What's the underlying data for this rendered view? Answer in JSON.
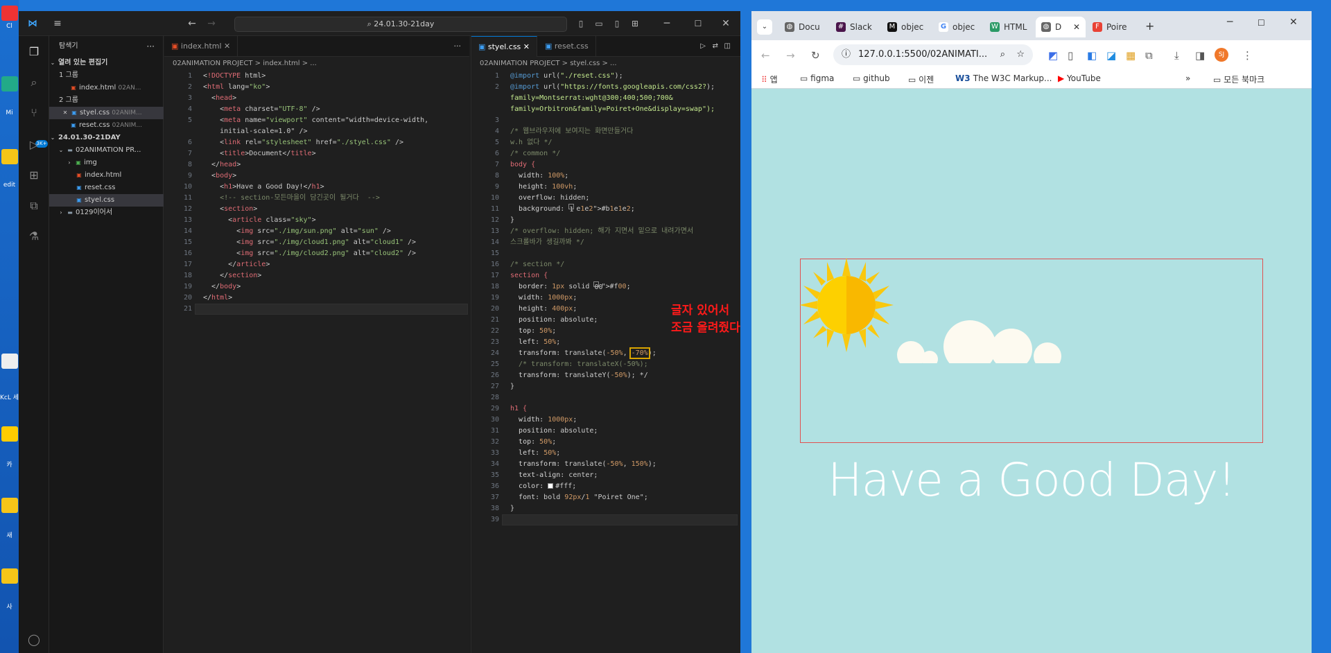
{
  "desktop": {
    "labels": [
      "Cl",
      "Mi",
      "edit",
      "KcL\n세무",
      "카",
      "새",
      "사"
    ]
  },
  "vscode": {
    "search_text": "24.01.30-21day",
    "explorer": {
      "title": "탐색기",
      "open_editors": "열려 있는 편집기",
      "group1": "1 그룹",
      "group2": "2 그룹",
      "open_files": [
        {
          "name": "index.html",
          "path": "02AN..."
        },
        {
          "name": "styel.css",
          "path": "02ANIM..."
        },
        {
          "name": "reset.css",
          "path": "02ANIM..."
        }
      ],
      "folder": "24.01.30-21DAY",
      "project": "02ANIMATION PR...",
      "items": [
        "img",
        "index.html",
        "reset.css",
        "styel.css"
      ],
      "other_folder": "0129이어서"
    },
    "left_editor": {
      "tab": "index.html",
      "breadcrumb": "02ANIMATION PROJECT > index.html > ...",
      "lines": [
        "<!DOCTYPE html>",
        "<html lang=\"ko\">",
        "  <head>",
        "    <meta charset=\"UTF-8\" />",
        "    <meta name=\"viewport\" content=\"width=device-width,",
        "    initial-scale=1.0\" />",
        "    <link rel=\"stylesheet\" href=\"./styel.css\" />",
        "    <title>Document</title>",
        "  </head>",
        "  <body>",
        "    <h1>Have a Good Day!</h1>",
        "    <!-- section-모든마을이 담긴곳이 될거다  -->",
        "    <section>",
        "      <article class=\"sky\">",
        "        <img src=\"./img/sun.png\" alt=\"sun\" />",
        "        <img src=\"./img/cloud1.png\" alt=\"cloud1\" />",
        "        <img src=\"./img/cloud2.png\" alt=\"cloud2\" />",
        "      </article>",
        "    </section>",
        "  </body>",
        "</html>",
        ""
      ],
      "line_numbers": [
        "1",
        "2",
        "3",
        "4",
        "5",
        "",
        "6",
        "7",
        "8",
        "9",
        "10",
        "11",
        "12",
        "13",
        "14",
        "15",
        "16",
        "17",
        "18",
        "19",
        "20",
        "21"
      ]
    },
    "right_editor": {
      "tab_active": "styel.css",
      "tab_other": "reset.css",
      "breadcrumb": "02ANIMATION PROJECT > styel.css > ...",
      "line_numbers": [
        "1",
        "2",
        "",
        "",
        "3",
        "4",
        "5",
        "6",
        "7",
        "8",
        "9",
        "10",
        "11",
        "12",
        "13",
        "14",
        "15",
        "16",
        "17",
        "18",
        "19",
        "20",
        "21",
        "22",
        "23",
        "24",
        "25",
        "26",
        "27",
        "28",
        "29",
        "30",
        "31",
        "32",
        "33",
        "34",
        "35",
        "36",
        "37",
        "38",
        "39"
      ],
      "lines": [
        "@import url(\"./reset.css\");",
        "@import url(\"https://fonts.googleapis.com/css2?",
        "family=Montserrat:wght@300;400;500;700&",
        "family=Orbitron&family=Poiret+One&display=swap\");",
        "",
        "/* 웹브라우저에 보여지는 화면만들거다",
        "w.h 없다 */",
        "/* common */",
        "body {",
        "  width: 100%;",
        "  height: 100vh;",
        "  overflow: hidden;",
        "  background: #b1e1e2;",
        "}",
        "/* overflow: hidden; 해가 지면서 밑으로 내려가면서",
        "스크롤바가 생길까봐 */",
        "",
        "/* section */",
        "section {",
        "  border: 1px solid #f00;",
        "  width: 1000px;",
        "  height: 400px;",
        "  position: absolute;",
        "  top: 50%;",
        "  left: 50%;",
        "  transform: translate(-50%, -70%);",
        "  /* transform: translateX(-50%);",
        "  transform: translateY(-50%); */",
        "}",
        "",
        "h1 {",
        "  width: 1000px;",
        "  position: absolute;",
        "  top: 50%;",
        "  left: 50%;",
        "  transform: translate(-50%, 150%);",
        "  text-align: center;",
        "  color: #fff;",
        "  font: bold 92px/1 \"Poiret One\";",
        "}",
        ""
      ]
    },
    "annotation": "글자 있어서\n조금 올려줬다"
  },
  "browser": {
    "tabs": [
      "Docu",
      "Slack",
      "objec",
      "objec",
      "HTML",
      "D",
      "Poire"
    ],
    "url": "127.0.0.1:5500/02ANIMATI...",
    "bookmarks": [
      "앱",
      "figma",
      "github",
      "이젠",
      "The W3C Markup...",
      "YouTube",
      "모든 북마크"
    ],
    "profile": "SJ",
    "page_heading": "Have a Good Day!",
    "colors": {
      "page_bg": "#b1e1e2",
      "section_border": "#f00",
      "sun": "#fdd000"
    }
  }
}
